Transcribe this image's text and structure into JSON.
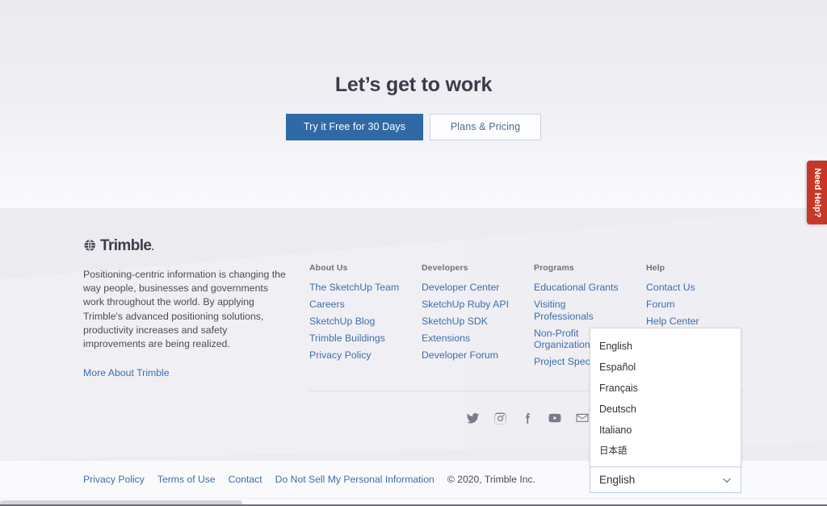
{
  "hero": {
    "title": "Let’s get to work",
    "primary_cta": "Try it Free for 30 Days",
    "secondary_cta": "Plans & Pricing"
  },
  "footer": {
    "brand": {
      "logo_text": "Trimble",
      "logo_mark": "globe-icon",
      "description": "Positioning-centric information is changing the way people, businesses and governments work throughout the world. By applying Trimble's advanced positioning solutions, productivity increases and safety improvements are being realized.",
      "link": "More About Trimble"
    },
    "columns": [
      {
        "title": "About Us",
        "links": [
          "The SketchUp Team",
          "Careers",
          "SketchUp Blog",
          "Trimble Buildings",
          "Privacy Policy"
        ]
      },
      {
        "title": "Developers",
        "links": [
          "Developer Center",
          "SketchUp Ruby API",
          "SketchUp SDK",
          "Extensions",
          "Developer Forum"
        ]
      },
      {
        "title": "Programs",
        "links": [
          "Educational Grants",
          "Visiting Professionals",
          "Non-Profit Organizations",
          "Project Spectrum"
        ]
      },
      {
        "title": "Help",
        "links": [
          "Contact Us",
          "Forum",
          "Help Center"
        ]
      }
    ],
    "socials": [
      {
        "name": "twitter-icon",
        "label": "Twitter"
      },
      {
        "name": "instagram-icon",
        "label": "Instagram"
      },
      {
        "name": "facebook-icon",
        "label": "Facebook"
      },
      {
        "name": "youtube-icon",
        "label": "YouTube"
      },
      {
        "name": "email-icon",
        "label": "Email"
      }
    ]
  },
  "bottombar": {
    "links": [
      "Privacy Policy",
      "Terms of Use",
      "Contact",
      "Do Not Sell My Personal Information"
    ],
    "copyright": "© 2020, Trimble Inc."
  },
  "language_select": {
    "value": "English",
    "expanded": true,
    "options": [
      "English",
      "Español",
      "Français",
      "Deutsch",
      "Italiano",
      "日本語"
    ]
  },
  "need_help": {
    "label": "Need Help?",
    "color": "#c73727"
  },
  "colors": {
    "hero_bg_top": "#eaeaf0",
    "hero_bg_bottom": "#fafafc",
    "footer_bg": "#ebebf0",
    "bottombar_bg": "#fafafc",
    "link_blue": "#3d6eaa",
    "primary_button": "#2f6aa6",
    "heading": "#3b3b4d"
  }
}
